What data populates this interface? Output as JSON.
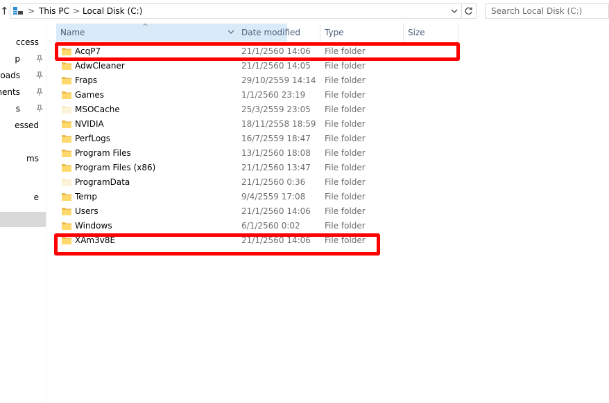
{
  "address_bar": {
    "breadcrumb": [
      "This PC",
      "Local Disk (C:)"
    ],
    "separator": ">",
    "search_placeholder": "Search Local Disk (C:)"
  },
  "nav_pane": {
    "items": [
      {
        "label": "ccess",
        "pinned": false
      },
      {
        "label": "p",
        "pinned": true
      },
      {
        "label": "oads",
        "pinned": true
      },
      {
        "label": "ments",
        "pinned": true
      },
      {
        "label": "s",
        "pinned": true
      },
      {
        "label": "essed",
        "pinned": false
      },
      {
        "label": "",
        "pinned": false
      },
      {
        "label": "ms",
        "pinned": false
      },
      {
        "label": "",
        "pinned": false
      },
      {
        "label": "e",
        "pinned": false
      },
      {
        "label": "",
        "pinned": false,
        "selected": true
      }
    ]
  },
  "columns": {
    "name": "Name",
    "date": "Date modified",
    "type": "Type",
    "size": "Size"
  },
  "files": [
    {
      "name": "AcqP7",
      "date": "21/1/2560 14:06",
      "type": "File folder",
      "icon": "folder-icon"
    },
    {
      "name": "AdwCleaner",
      "date": "21/1/2560 14:05",
      "type": "File folder",
      "icon": "folder-icon"
    },
    {
      "name": "Fraps",
      "date": "29/10/2559 14:14",
      "type": "File folder",
      "icon": "folder-icon"
    },
    {
      "name": "Games",
      "date": "1/1/2560 23:19",
      "type": "File folder",
      "icon": "folder-icon"
    },
    {
      "name": "MSOCache",
      "date": "25/3/2559 23:05",
      "type": "File folder",
      "icon": "hidden-folder-icon"
    },
    {
      "name": "NVIDIA",
      "date": "18/11/2558 18:59",
      "type": "File folder",
      "icon": "folder-icon"
    },
    {
      "name": "PerfLogs",
      "date": "16/7/2559 18:47",
      "type": "File folder",
      "icon": "folder-icon"
    },
    {
      "name": "Program Files",
      "date": "13/1/2560 18:08",
      "type": "File folder",
      "icon": "folder-icon"
    },
    {
      "name": "Program Files (x86)",
      "date": "21/1/2560 13:47",
      "type": "File folder",
      "icon": "folder-icon"
    },
    {
      "name": "ProgramData",
      "date": "21/1/2560 0:36",
      "type": "File folder",
      "icon": "hidden-folder-icon"
    },
    {
      "name": "Temp",
      "date": "9/4/2559 17:08",
      "type": "File folder",
      "icon": "folder-icon"
    },
    {
      "name": "Users",
      "date": "21/1/2560 14:06",
      "type": "File folder",
      "icon": "folder-icon"
    },
    {
      "name": "Windows",
      "date": "6/1/2560 0:02",
      "type": "File folder",
      "icon": "folder-icon"
    },
    {
      "name": "XAm3v8E",
      "date": "21/1/2560 14:06",
      "type": "File folder",
      "icon": "folder-icon"
    }
  ],
  "highlights": {
    "color": "#ff0000",
    "rows": [
      "AcqP7",
      "XAm3v8E"
    ]
  },
  "colors": {
    "header_active": "#d9ebf9",
    "header_text": "#4c607a",
    "folder": "#ffd96b",
    "selected_nav": "#d9d9d9"
  }
}
